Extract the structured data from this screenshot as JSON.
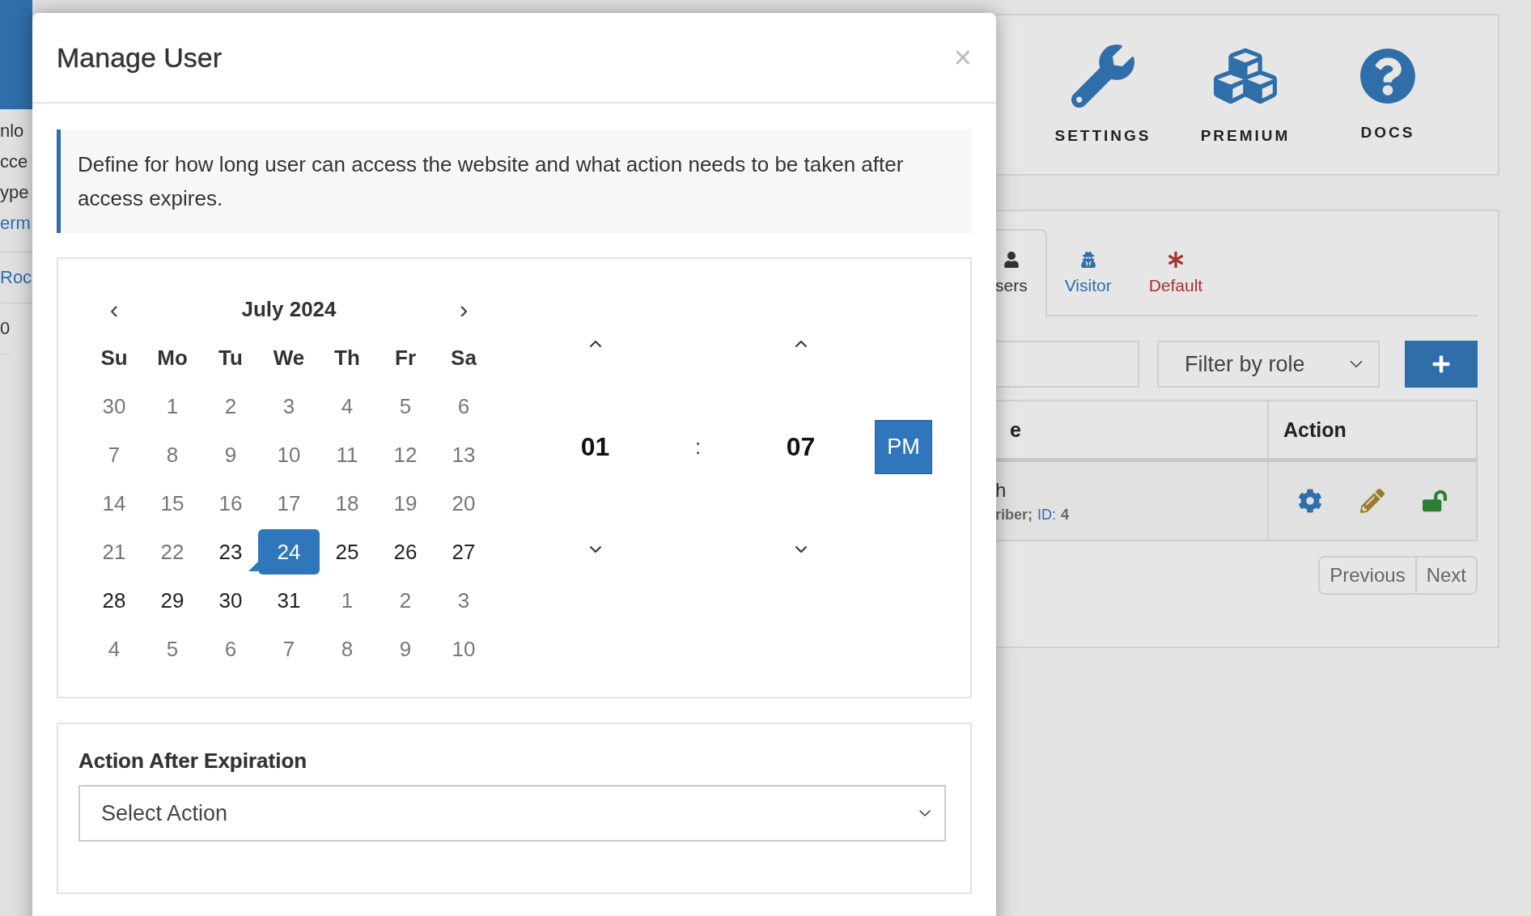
{
  "background": {
    "left_fragments": [
      {
        "text": "nlo",
        "link": false
      },
      {
        "text": "cce",
        "link": false
      },
      {
        "text": "ype",
        "link": false
      },
      {
        "text": "erm",
        "link": true
      },
      {
        "text": "Roc",
        "link": true
      },
      {
        "text": "0",
        "link": false
      }
    ],
    "shortcuts": [
      {
        "kind": "settings",
        "label": "SETTINGS"
      },
      {
        "kind": "premium",
        "label": "PREMIUM"
      },
      {
        "kind": "docs",
        "label": "DOCS"
      }
    ],
    "tabs": [
      {
        "kind": "users",
        "label": "sers",
        "selected": true,
        "color": "#333333"
      },
      {
        "kind": "visitor",
        "label": "Visitor",
        "selected": false,
        "color": "#2f6ea9"
      },
      {
        "kind": "default",
        "label": "Default",
        "selected": false,
        "color": "#a83232"
      }
    ],
    "filter": {
      "value": "Filter by role"
    },
    "table": {
      "columns": [
        "e",
        "Action"
      ],
      "rows": [
        {
          "name": "h",
          "role": "riber;",
          "id_label": "ID:",
          "id": "4"
        }
      ]
    },
    "pagination": [
      "Previous",
      "Next"
    ]
  },
  "modal": {
    "title": "Manage User",
    "close": "×",
    "info": "Define for how long user can access the website and what action needs to be taken after access expires.",
    "calendar": {
      "prev": "‹",
      "month": "July 2024",
      "next": "›",
      "weekdays": [
        "Su",
        "Mo",
        "Tu",
        "We",
        "Th",
        "Fr",
        "Sa"
      ],
      "weeks": [
        [
          {
            "label": "30",
            "muted": true,
            "today": false,
            "selected": false
          },
          {
            "label": "1",
            "muted": true,
            "today": false,
            "selected": false
          },
          {
            "label": "2",
            "muted": true,
            "today": false,
            "selected": false
          },
          {
            "label": "3",
            "muted": true,
            "today": false,
            "selected": false
          },
          {
            "label": "4",
            "muted": true,
            "today": false,
            "selected": false
          },
          {
            "label": "5",
            "muted": true,
            "today": false,
            "selected": false
          },
          {
            "label": "6",
            "muted": true,
            "today": false,
            "selected": false
          }
        ],
        [
          {
            "label": "7",
            "muted": true,
            "today": false,
            "selected": false
          },
          {
            "label": "8",
            "muted": true,
            "today": false,
            "selected": false
          },
          {
            "label": "9",
            "muted": true,
            "today": false,
            "selected": false
          },
          {
            "label": "10",
            "muted": true,
            "today": false,
            "selected": false
          },
          {
            "label": "11",
            "muted": true,
            "today": false,
            "selected": false
          },
          {
            "label": "12",
            "muted": true,
            "today": false,
            "selected": false
          },
          {
            "label": "13",
            "muted": true,
            "today": false,
            "selected": false
          }
        ],
        [
          {
            "label": "14",
            "muted": true,
            "today": false,
            "selected": false
          },
          {
            "label": "15",
            "muted": true,
            "today": false,
            "selected": false
          },
          {
            "label": "16",
            "muted": true,
            "today": false,
            "selected": false
          },
          {
            "label": "17",
            "muted": true,
            "today": false,
            "selected": false
          },
          {
            "label": "18",
            "muted": true,
            "today": false,
            "selected": false
          },
          {
            "label": "19",
            "muted": true,
            "today": false,
            "selected": false
          },
          {
            "label": "20",
            "muted": true,
            "today": false,
            "selected": false
          }
        ],
        [
          {
            "label": "21",
            "muted": true,
            "today": false,
            "selected": false
          },
          {
            "label": "22",
            "muted": true,
            "today": false,
            "selected": false
          },
          {
            "label": "23",
            "muted": false,
            "today": true,
            "selected": false
          },
          {
            "label": "24",
            "muted": false,
            "today": false,
            "selected": true
          },
          {
            "label": "25",
            "muted": false,
            "today": false,
            "selected": false
          },
          {
            "label": "26",
            "muted": false,
            "today": false,
            "selected": false
          },
          {
            "label": "27",
            "muted": false,
            "today": false,
            "selected": false
          }
        ],
        [
          {
            "label": "28",
            "muted": false,
            "today": false,
            "selected": false
          },
          {
            "label": "29",
            "muted": false,
            "today": false,
            "selected": false
          },
          {
            "label": "30",
            "muted": false,
            "today": false,
            "selected": false
          },
          {
            "label": "31",
            "muted": false,
            "today": false,
            "selected": false
          },
          {
            "label": "1",
            "muted": true,
            "today": false,
            "selected": false
          },
          {
            "label": "2",
            "muted": true,
            "today": false,
            "selected": false
          },
          {
            "label": "3",
            "muted": true,
            "today": false,
            "selected": false
          }
        ],
        [
          {
            "label": "4",
            "muted": true,
            "today": false,
            "selected": false
          },
          {
            "label": "5",
            "muted": true,
            "today": false,
            "selected": false
          },
          {
            "label": "6",
            "muted": true,
            "today": false,
            "selected": false
          },
          {
            "label": "7",
            "muted": true,
            "today": false,
            "selected": false
          },
          {
            "label": "8",
            "muted": true,
            "today": false,
            "selected": false
          },
          {
            "label": "9",
            "muted": true,
            "today": false,
            "selected": false
          },
          {
            "label": "10",
            "muted": true,
            "today": false,
            "selected": false
          }
        ]
      ]
    },
    "time": {
      "hour": "01",
      "separator": ":",
      "minute": "07",
      "period": "PM"
    },
    "action": {
      "label": "Action After Expiration",
      "placeholder": "Select Action"
    }
  }
}
